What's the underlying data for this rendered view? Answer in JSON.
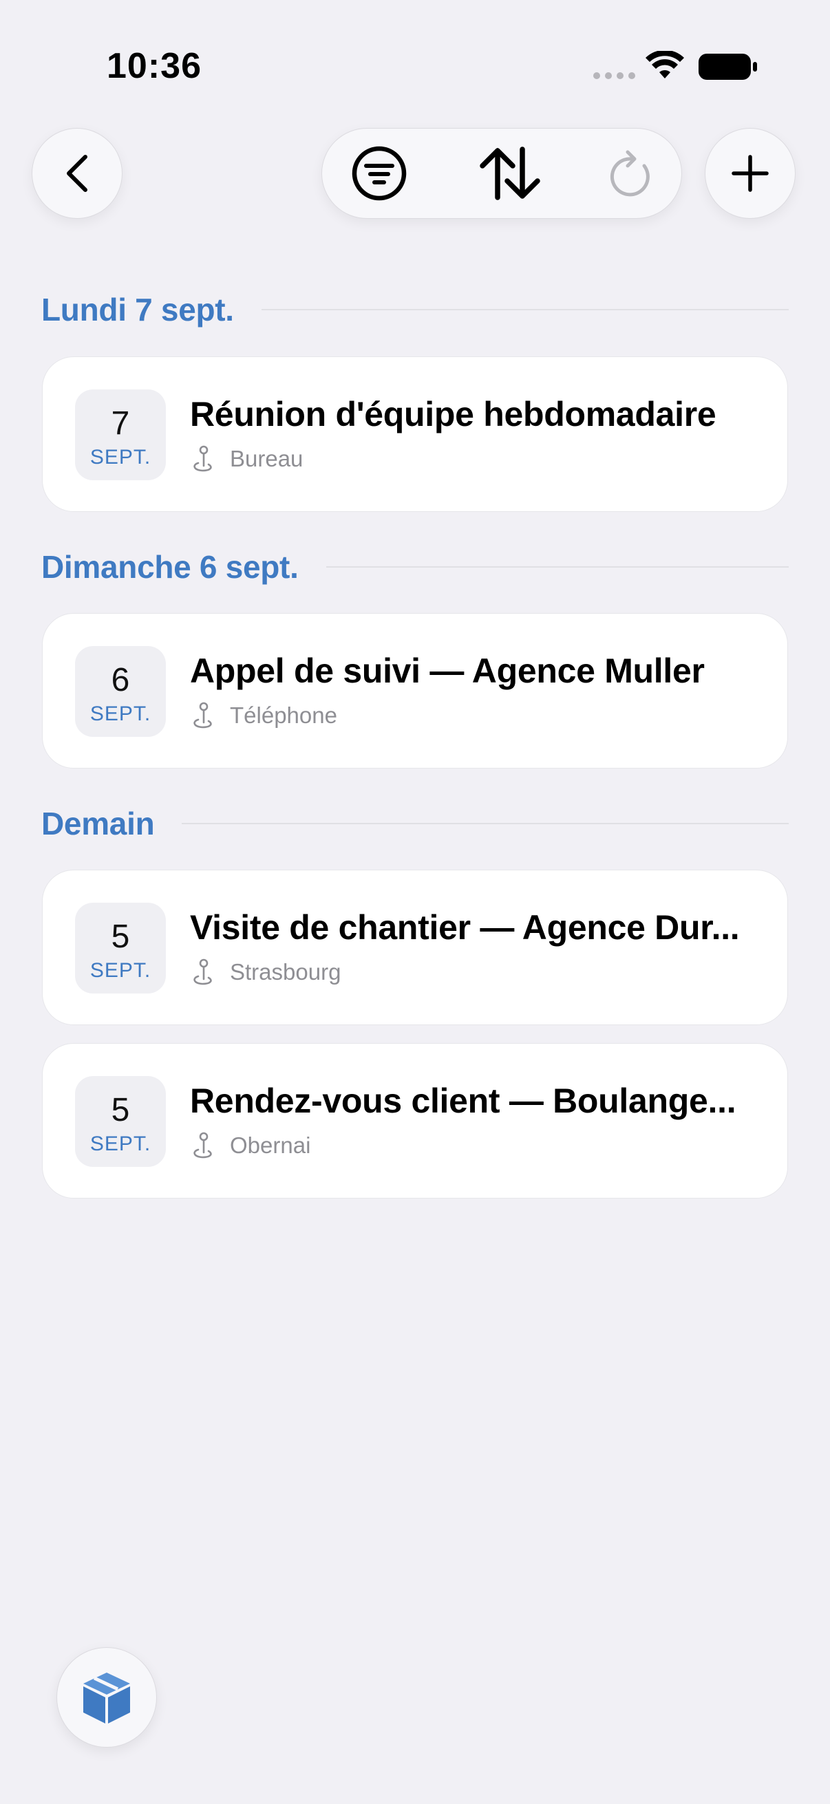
{
  "status_bar": {
    "time": "10:36"
  },
  "toolbar": {
    "back_icon": "chevron-left-icon",
    "filter_icon": "filter-lines-icon",
    "sort_icon": "arrow-up-down-icon",
    "refresh_icon": "refresh-icon",
    "add_icon": "plus-icon"
  },
  "colors": {
    "accent": "#3f7ac2",
    "background": "#f1f0f5",
    "card": "#ffffff",
    "secondary_text": "#8e8e93"
  },
  "sections": [
    {
      "title": "Lundi 7 sept.",
      "events": [
        {
          "day": "7",
          "month": "SEPT.",
          "title": "Réunion d'équipe hebdomadaire",
          "location": "Bureau"
        }
      ]
    },
    {
      "title": "Dimanche 6 sept.",
      "events": [
        {
          "day": "6",
          "month": "SEPT.",
          "title": "Appel de suivi — Agence Muller",
          "location": "Téléphone"
        }
      ]
    },
    {
      "title": "Demain",
      "events": [
        {
          "day": "5",
          "month": "SEPT.",
          "title": "Visite de chantier — Agence Dur...",
          "location": "Strasbourg"
        },
        {
          "day": "5",
          "month": "SEPT.",
          "title": "Rendez-vous client — Boulange...",
          "location": "Obernai"
        }
      ]
    }
  ],
  "floating_button": {
    "icon": "cube-box-icon"
  }
}
